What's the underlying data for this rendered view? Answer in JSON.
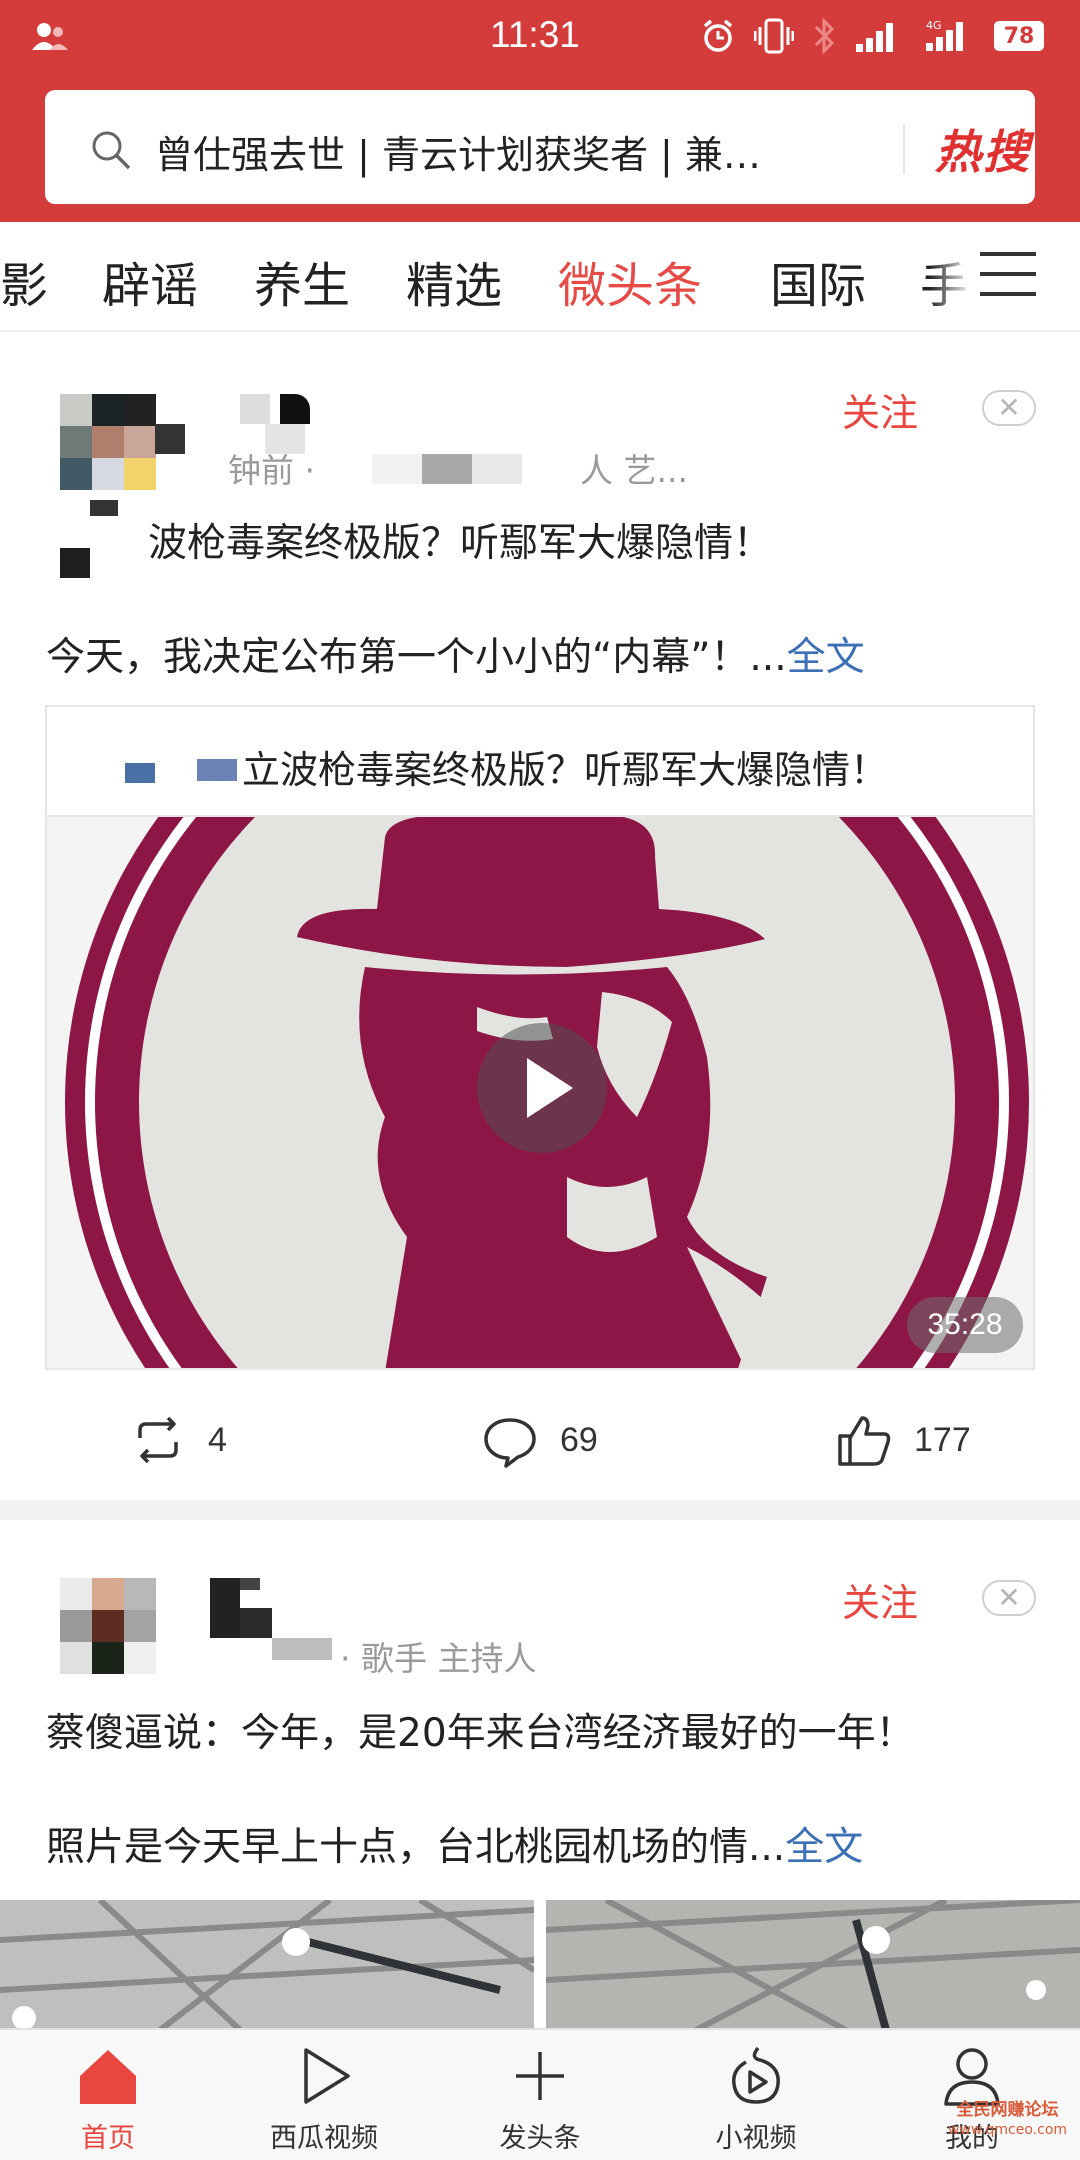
{
  "status_bar": {
    "time": "11:31",
    "battery": "78",
    "net_label": "4G"
  },
  "search": {
    "text": "曾仕强去世 | 青云计划获奖者 | 兼…",
    "hot_label": "热搜"
  },
  "tabs": [
    {
      "label": "影"
    },
    {
      "label": "辟谣"
    },
    {
      "label": "养生"
    },
    {
      "label": "精选"
    },
    {
      "label": "微头条"
    },
    {
      "label": "国际"
    },
    {
      "label": "手"
    }
  ],
  "post1": {
    "follow": "关注",
    "meta_left": "钟前 ·",
    "meta_right": "人 艺...",
    "title": "波枪毒案终极版？听鄢军大爆隐情！",
    "body": "今天，我决定公布第一个小小的“内幕”！...",
    "more": "全文",
    "share_title": "立波枪毒案终极版？听鄢军大爆隐情！",
    "duration": "35:28",
    "repost_count": "4",
    "comment_count": "69",
    "like_count": "177"
  },
  "post2": {
    "follow": "关注",
    "meta": "· 歌手 主持人",
    "line1": "蔡傻逼说：今年，是20年来台湾经济最好的一年！",
    "line2": "照片是今天早上十点，台北桃园机场的情...",
    "more": "全文"
  },
  "bottom_nav": [
    {
      "label": "首页"
    },
    {
      "label": "西瓜视频"
    },
    {
      "label": "发头条"
    },
    {
      "label": "小视频"
    },
    {
      "label": "我的"
    }
  ],
  "watermark": {
    "line1": "全民网赚论坛",
    "line2": "www.qmceo.com"
  },
  "colors": {
    "brand_red": "#d43c3c",
    "active_tab": "#e84a46",
    "link_blue": "#3b6fb6",
    "art_maroon": "#8e1646"
  }
}
